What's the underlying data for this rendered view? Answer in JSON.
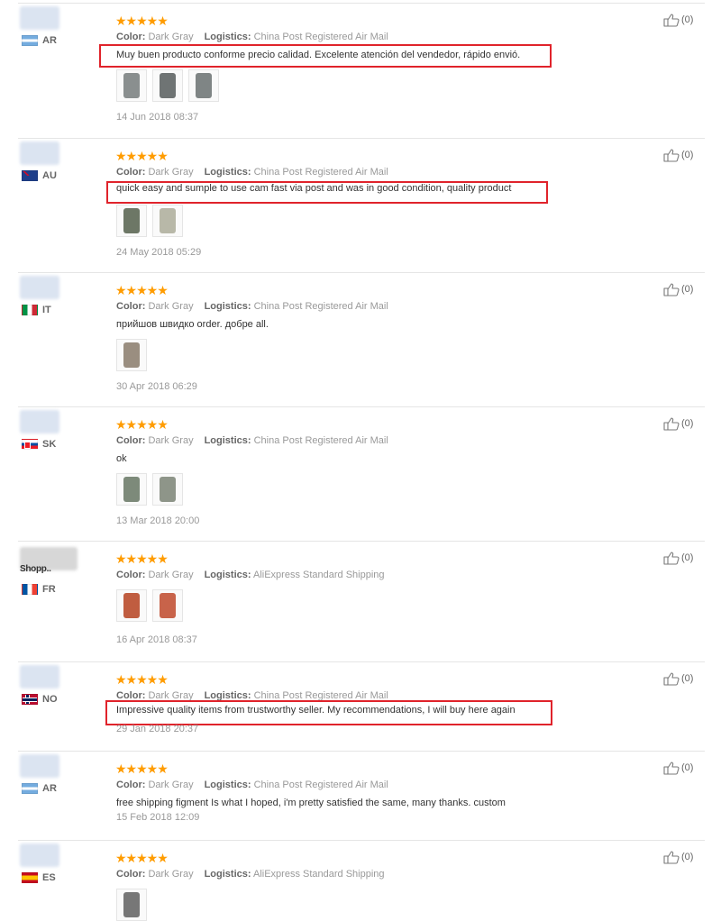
{
  "helpful_label": "(0)",
  "meta_labels": {
    "color": "Color:",
    "logistics": "Logistics:"
  },
  "reviews": [
    {
      "country": "AR",
      "flag": "ar",
      "color": "Dark Gray",
      "logistics": "China Post Registered Air Mail",
      "text": "Muy buen producto conforme precio calidad. Excelente atención del vendedor, rápido envió.",
      "highlighted": true,
      "photos": 3,
      "date": "14 Jun 2018 08:37"
    },
    {
      "country": "AU",
      "flag": "au",
      "color": "Dark Gray",
      "logistics": "China Post Registered Air Mail",
      "text": "quick easy and sumple to use cam fast via post and was in good condition, quality product",
      "highlighted": true,
      "photos": 2,
      "date": "24 May 2018 05:29"
    },
    {
      "country": "IT",
      "flag": "it",
      "color": "Dark Gray",
      "logistics": "China Post Registered Air Mail",
      "text": "прийшов швидко order. добре all.",
      "highlighted": false,
      "photos": 1,
      "date": "30 Apr 2018 06:29"
    },
    {
      "country": "SK",
      "flag": "sk",
      "color": "Dark Gray",
      "logistics": "China Post Registered Air Mail",
      "text": "ok",
      "highlighted": false,
      "photos": 2,
      "date": "13 Mar 2018 20:00"
    },
    {
      "country": "FR",
      "flag": "fr",
      "partial_name": "Shopp..",
      "color": "Dark Gray",
      "logistics": "AliExpress Standard Shipping",
      "text": "",
      "highlighted": false,
      "photos": 2,
      "date": "16 Apr 2018 08:37"
    },
    {
      "country": "NO",
      "flag": "no",
      "color": "Dark Gray",
      "logistics": "China Post Registered Air Mail",
      "text": "Impressive quality items from trustworthy seller. My recommendations, I will buy here again",
      "highlighted": true,
      "photos": 0,
      "date": "29 Jan 2018 20:37"
    },
    {
      "country": "AR",
      "flag": "ar",
      "color": "Dark Gray",
      "logistics": "China Post Registered Air Mail",
      "text": "free shipping figment Is what I hoped, i'm pretty satisfied the same, many thanks. custom",
      "highlighted": false,
      "photos": 0,
      "date": "15 Feb 2018 12:09"
    },
    {
      "country": "ES",
      "flag": "es",
      "color": "Dark Gray",
      "logistics": "AliExpress Standard Shipping",
      "text": "",
      "highlighted": false,
      "photos": 1,
      "date": ""
    }
  ],
  "star_glyphs": "★★★★★",
  "colors": {
    "star": "#ff9c00",
    "highlight": "#e0232b"
  }
}
